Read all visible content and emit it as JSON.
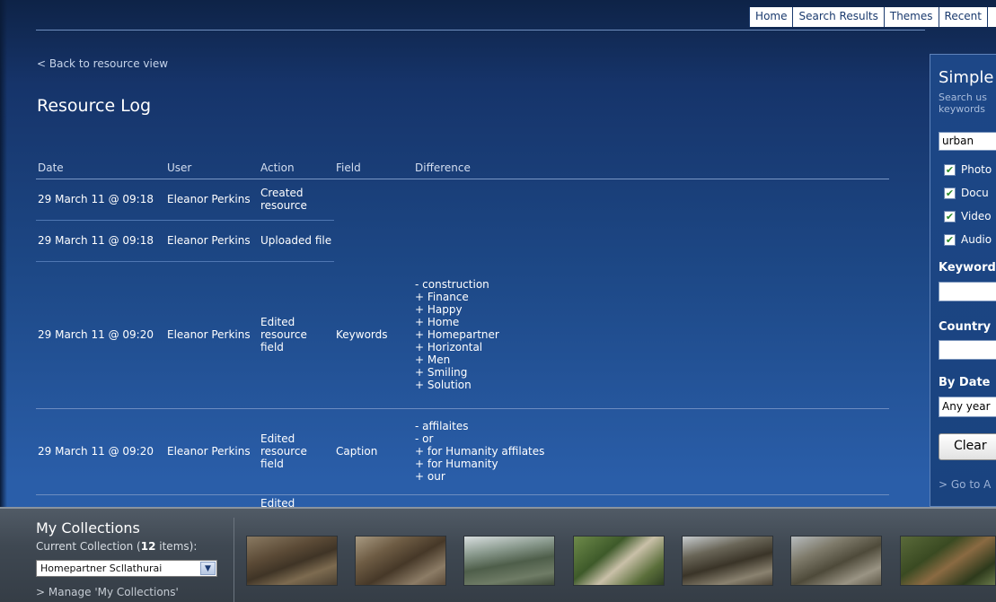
{
  "nav": {
    "items": [
      "Home",
      "Search Results",
      "Themes",
      "Recent"
    ]
  },
  "page": {
    "back_link": "< Back to resource view",
    "title": "Resource Log"
  },
  "log": {
    "headers": {
      "date": "Date",
      "user": "User",
      "action": "Action",
      "field": "Field",
      "difference": "Difference"
    },
    "rows": [
      {
        "date": "29 March 11 @ 09:18",
        "user": "Eleanor Perkins",
        "action": "Created resource",
        "field": "",
        "difference": []
      },
      {
        "date": "29 March 11 @ 09:18",
        "user": "Eleanor Perkins",
        "action": "Uploaded file",
        "field": "",
        "difference": []
      },
      {
        "date": "29 March 11 @ 09:20",
        "user": "Eleanor Perkins",
        "action": "Edited resource field",
        "field": "Keywords",
        "difference": [
          "- construction",
          "+ Finance",
          "+ Happy",
          "+ Home",
          "+ Homepartner",
          "+ Horizontal",
          "+ Men",
          "+ Smiling",
          "+ Solution"
        ]
      },
      {
        "date": "29 March 11 @ 09:20",
        "user": "Eleanor Perkins",
        "action": "Edited resource field",
        "field": "Caption",
        "difference": [
          "- affilaites",
          "- or",
          "+ for Humanity affilates",
          "+ for Humanity",
          "+ our"
        ]
      },
      {
        "date": "",
        "user": "",
        "action": "Edited",
        "field": "",
        "difference": []
      }
    ]
  },
  "search_panel": {
    "title": "Simple",
    "hint_line1": "Search us",
    "hint_line2": "keywords",
    "query_value": "urban",
    "checkboxes": [
      {
        "label": "Photo",
        "checked": true
      },
      {
        "label": "Docu",
        "checked": true
      },
      {
        "label": "Video",
        "checked": true
      },
      {
        "label": "Audio",
        "checked": true
      }
    ],
    "keyword_label": "Keyword",
    "country_label": "Country",
    "date_label": "By Date",
    "date_select": "Any year",
    "clear_button": "Clear",
    "advanced_link": "> Go to A"
  },
  "collections": {
    "title": "My Collections",
    "current_prefix": "Current Collection (",
    "item_count": "12",
    "current_suffix": " items):",
    "selected": "Homepartner Scllathurai",
    "manage_link": "> Manage 'My Collections'",
    "thumb_count": 7
  },
  "colors": {
    "page_bg": "#1d4886",
    "bar_bg": "#3f4852",
    "panel_bg": "#1d4787"
  }
}
